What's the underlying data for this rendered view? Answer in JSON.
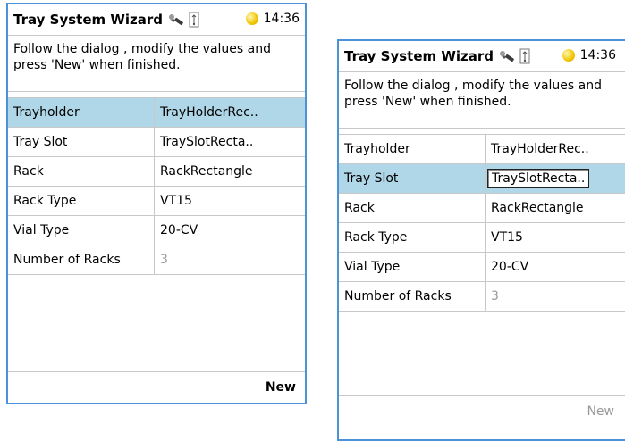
{
  "left": {
    "title": "Tray System Wizard",
    "time": "14:36",
    "instructions": "Follow the dialog , modify the values and press 'New' when finished.",
    "rows": [
      {
        "label": "Trayholder",
        "value": "TrayHolderRec.."
      },
      {
        "label": "Tray Slot",
        "value": "TraySlotRecta.."
      },
      {
        "label": "Rack",
        "value": "RackRectangle"
      },
      {
        "label": "Rack Type",
        "value": "VT15"
      },
      {
        "label": "Vial Type",
        "value": "20-CV"
      },
      {
        "label": "Number of Racks",
        "value": "3"
      }
    ],
    "new_label": "New"
  },
  "right": {
    "title": "Tray System Wizard",
    "time": "14:36",
    "instructions": "Follow the dialog , modify the values and press 'New' when finished.",
    "rows": [
      {
        "label": "Trayholder",
        "value": "TrayHolderRec.."
      },
      {
        "label": "Tray Slot",
        "value": "TraySlotRecta.."
      },
      {
        "label": "Rack",
        "value": "RackRectangle"
      },
      {
        "label": "Rack Type",
        "value": "VT15"
      },
      {
        "label": "Vial Type",
        "value": "20-CV"
      },
      {
        "label": "Number of Racks",
        "value": "3"
      }
    ],
    "new_label": "New"
  },
  "icons": {
    "tool": "wrench-icon",
    "usb": "usb-icon",
    "status": "status-dot-icon"
  },
  "colors": {
    "border": "#4b93d6",
    "selection": "#afd7e8",
    "status_dot": "#f0c400",
    "disabled_text": "#9a9a9a"
  }
}
